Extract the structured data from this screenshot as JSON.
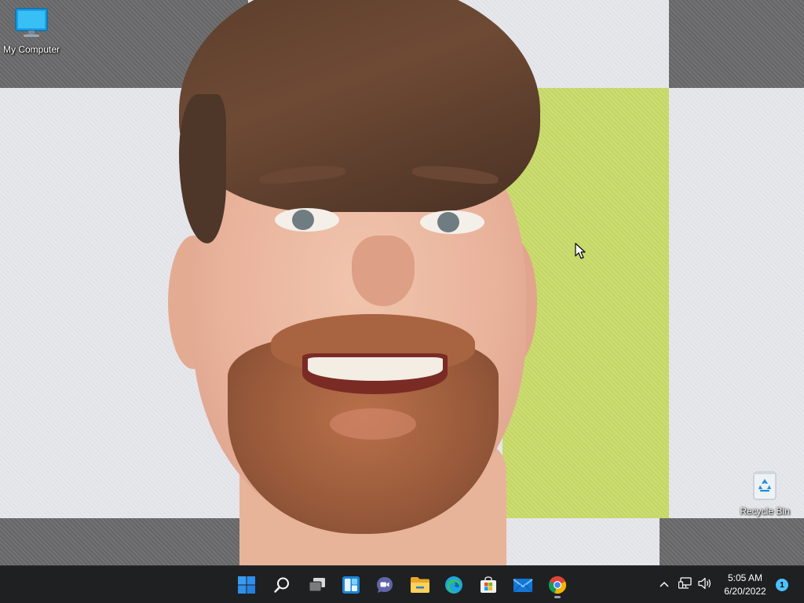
{
  "desktop": {
    "icons": [
      {
        "label": "My Computer",
        "icon": "monitor-icon"
      },
      {
        "label": "Recycle Bin",
        "icon": "recycle-bin-icon"
      }
    ]
  },
  "taskbar": {
    "pinned": [
      {
        "name": "Start",
        "icon": "windows-start-icon"
      },
      {
        "name": "Search",
        "icon": "search-icon"
      },
      {
        "name": "Task View",
        "icon": "task-view-icon"
      },
      {
        "name": "Widgets",
        "icon": "widgets-icon"
      },
      {
        "name": "Chat",
        "icon": "chat-icon"
      },
      {
        "name": "File Explorer",
        "icon": "folder-icon"
      },
      {
        "name": "Microsoft Edge",
        "icon": "edge-icon"
      },
      {
        "name": "Microsoft Store",
        "icon": "store-icon"
      },
      {
        "name": "Mail",
        "icon": "mail-icon"
      },
      {
        "name": "Google Chrome",
        "icon": "chrome-icon",
        "running": true
      }
    ],
    "tray": {
      "icons": [
        "chevron-up-icon",
        "network-icon",
        "volume-icon"
      ],
      "time": "5:05 AM",
      "date": "6/20/2022",
      "notification_count": "1"
    }
  },
  "colors": {
    "taskbar_bg": "#1f2022",
    "accent": "#4cc2ff",
    "start_blue": "#2f8fea"
  }
}
